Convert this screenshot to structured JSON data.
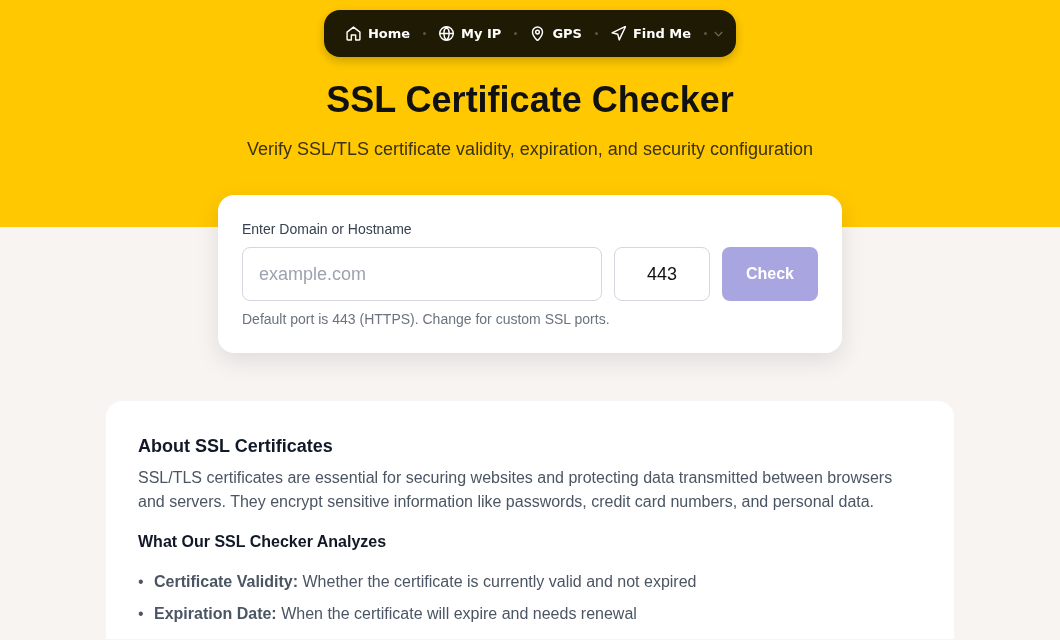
{
  "nav": {
    "items": [
      {
        "label": "Home"
      },
      {
        "label": "My IP"
      },
      {
        "label": "GPS"
      },
      {
        "label": "Find Me"
      }
    ]
  },
  "header": {
    "title": "SSL Certificate Checker",
    "subtitle": "Verify SSL/TLS certificate validity, expiration, and security configuration"
  },
  "checker": {
    "label": "Enter Domain or Hostname",
    "domain": {
      "placeholder": "example.com"
    },
    "port": {
      "value": "443"
    },
    "button": {
      "label": "Check",
      "disabled": true
    },
    "help": "Default port is 443 (HTTPS). Change for custom SSL ports."
  },
  "about": {
    "title": "About SSL Certificates",
    "paragraph": "SSL/TLS certificates are essential for securing websites and protecting data transmitted between browsers and servers. They encrypt sensitive information like passwords, credit card numbers, and personal data.",
    "subtitle": "What Our SSL Checker Analyzes",
    "items": [
      {
        "marker": "•",
        "text": "**Certificate Validity:** Whether the certificate is currently valid and not expired"
      },
      {
        "marker": "•",
        "text": "**Expiration Date:** When the certificate will expire and needs renewal"
      }
    ]
  }
}
